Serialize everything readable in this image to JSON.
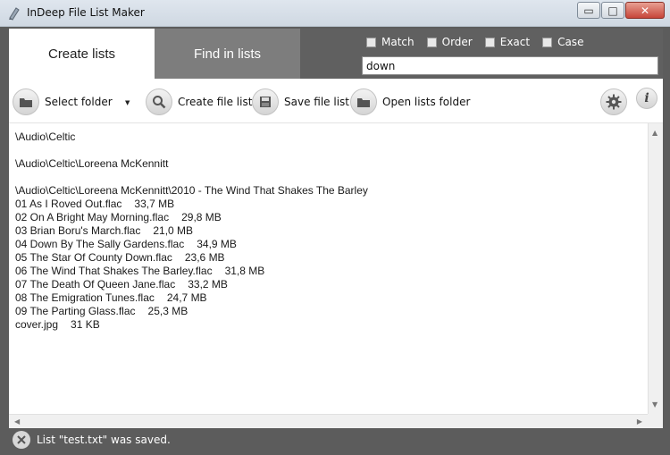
{
  "window": {
    "title": "InDeep File List Maker",
    "min_glyph": "▭",
    "max_glyph": "□",
    "close_glyph": "✕"
  },
  "tabs": {
    "create": "Create lists",
    "find": "Find in lists"
  },
  "search_options": {
    "match": "Match",
    "order": "Order",
    "exact": "Exact",
    "case": "Case"
  },
  "search": {
    "value": "down"
  },
  "toolbar": {
    "select_folder": "Select folder",
    "create_file_list": "Create file list",
    "save_file_list": "Save file list",
    "open_lists_folder": "Open lists folder",
    "info_glyph": "i"
  },
  "listing": [
    {
      "name": "\\Audio\\Celtic",
      "size": ""
    },
    {
      "name": "",
      "size": ""
    },
    {
      "name": "\\Audio\\Celtic\\Loreena McKennitt",
      "size": ""
    },
    {
      "name": "",
      "size": ""
    },
    {
      "name": "\\Audio\\Celtic\\Loreena McKennitt\\2010 - The Wind That Shakes The Barley",
      "size": ""
    },
    {
      "name": "01 As I Roved Out.flac",
      "size": "33,7 MB"
    },
    {
      "name": "02 On A Bright May Morning.flac",
      "size": "29,8 MB"
    },
    {
      "name": "03 Brian Boru's March.flac",
      "size": "21,0 MB"
    },
    {
      "name": "04 Down By The Sally Gardens.flac",
      "size": "34,9 MB"
    },
    {
      "name": "05 The Star Of County Down.flac",
      "size": "23,6 MB"
    },
    {
      "name": "06 The Wind That Shakes The Barley.flac",
      "size": "31,8 MB"
    },
    {
      "name": "07 The Death Of Queen Jane.flac",
      "size": "33,2 MB"
    },
    {
      "name": "08 The Emigration Tunes.flac",
      "size": "24,7 MB"
    },
    {
      "name": "09 The Parting Glass.flac",
      "size": "25,3 MB"
    },
    {
      "name": "cover.jpg",
      "size": "31 KB"
    }
  ],
  "status": {
    "message": "List \"test.txt\" was saved."
  }
}
